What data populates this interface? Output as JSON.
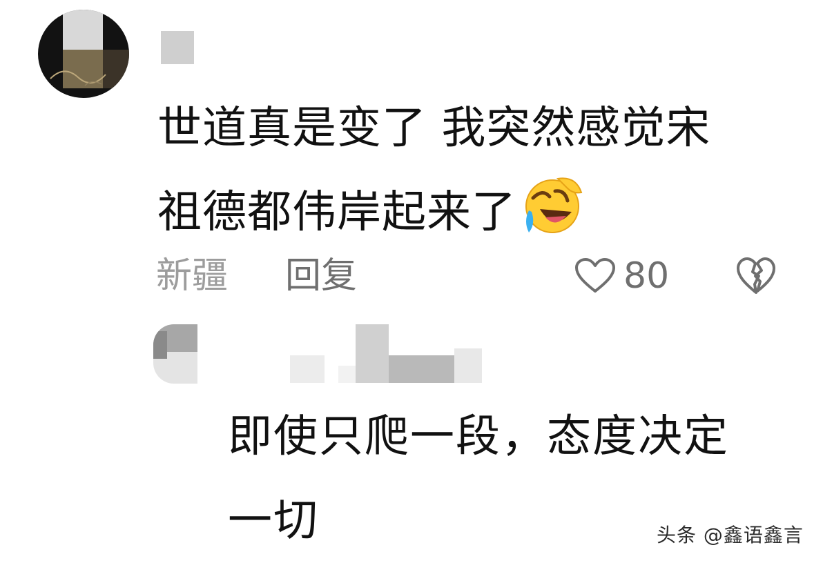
{
  "comments": [
    {
      "body_line_1": "世道真是变了 我突然感觉宋",
      "body_line_2": "祖德都伟岸起来了",
      "emoji": "rolling-on-floor-laughing-emoji",
      "location": "新疆",
      "reply_label": "回复",
      "like_count": "80",
      "icons": [
        "heart-outline-icon",
        "broken-heart-icon"
      ]
    },
    {
      "body": "即使只爬一段，态度决定\n一切"
    }
  ],
  "watermark": "头条 @鑫语鑫言",
  "colors": {
    "background": "#ffffff",
    "text": "#111111",
    "meta_gray": "#9c9c9c",
    "action_gray": "#6f6f6f"
  }
}
